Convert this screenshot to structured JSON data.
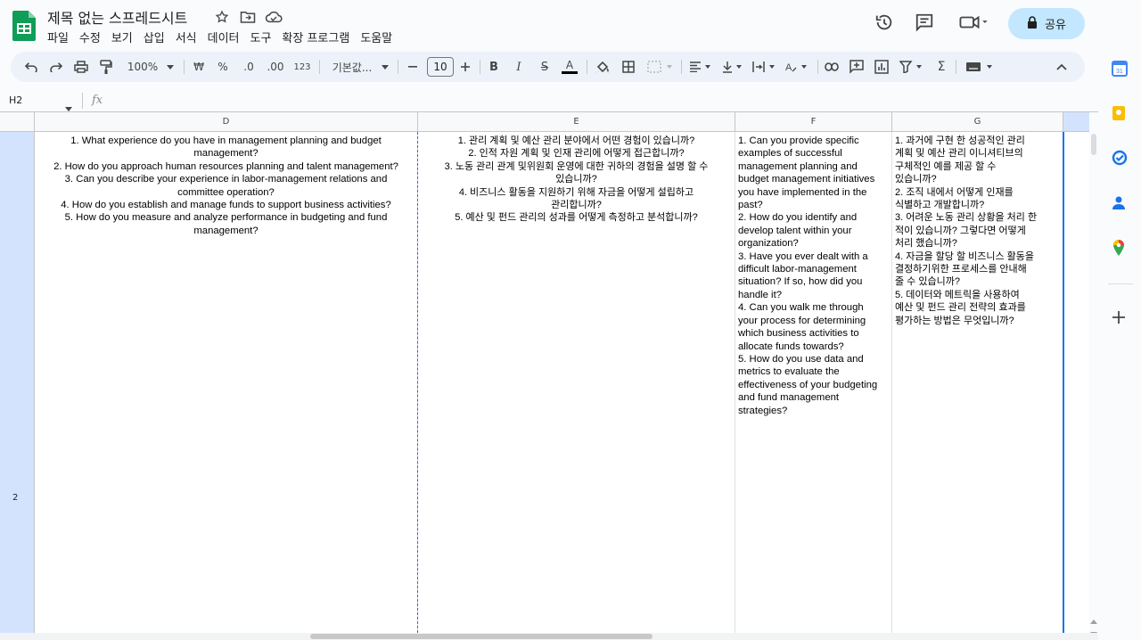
{
  "app": {
    "title": "제목 없는 스프레드시트",
    "share_label": "공유"
  },
  "menu": [
    "파일",
    "수정",
    "보기",
    "삽입",
    "서식",
    "데이터",
    "도구",
    "확장 프로그램",
    "도움말"
  ],
  "toolbar": {
    "zoom": "100%",
    "currency": "₩",
    "percent": "%",
    "decrease_decimal": ".0",
    "increase_decimal": ".00",
    "number_format": "123",
    "font": "기본값...",
    "font_size": "10",
    "bold": "B",
    "italic": "I",
    "strike": "S",
    "text_color": "A",
    "sum": "Σ"
  },
  "formula_bar": {
    "cell_ref": "H2",
    "fx": "fx"
  },
  "columns": [
    "D",
    "E",
    "F",
    "G"
  ],
  "row": "2",
  "cells": {
    "D": [
      "1. What experience do you have in management planning and budget",
      "management?",
      "2. How do you approach human resources planning and talent management?",
      "3. Can you describe your experience in labor-management relations and",
      "committee operation?",
      "4. How do you establish and manage funds to support business activities?",
      "5. How do you measure and analyze performance in budgeting and fund",
      "management?"
    ],
    "E": [
      "1. 관리 계획 및 예산 관리 분야에서 어떤 경험이 있습니까?",
      "2. 인적 자원 계획 및 인재 관리에 어떻게 접근합니까?",
      "3. 노동 관리 관계 및위원회 운영에 대한 귀하의 경험을 설명 할 수",
      "있습니까?",
      "4. 비즈니스 활동을 지원하기 위해 자금을 어떻게 설립하고",
      "관리합니까?",
      "5. 예산 및 펀드 관리의 성과를 어떻게 측정하고 분석합니까?"
    ],
    "F": [
      "1. Can you provide specific",
      "examples of successful",
      "management planning and",
      "budget management initiatives",
      "you have implemented in the",
      "past?",
      "2. How do you identify and",
      "develop talent within your",
      "organization?",
      "3. Have you ever dealt with a",
      "difficult labor-management",
      "situation? If so, how did you",
      "handle it?",
      "4. Can you walk me through",
      "your process for determining",
      "which business activities to",
      "allocate funds towards?",
      "5. How do you use data and",
      "metrics to evaluate the",
      "effectiveness of your budgeting",
      "and fund management",
      "strategies?"
    ],
    "G": [
      "1. 과거에 구현 한 성공적인 관리",
      "계획 및 예산 관리 이니셔티브의",
      "구체적인 예를 제공 할 수",
      "있습니까?",
      "2. 조직 내에서 어떻게 인재를",
      "식별하고 개발합니까?",
      "3. 어려운 노동 관리 상황을 처리 한",
      "적이 있습니까? 그렇다면 어떻게",
      "처리 했습니까?",
      "4. 자금을 할당 할 비즈니스 활동을",
      "결정하기위한 프로세스를 안내해",
      "줄 수 있습니까?",
      "5. 데이터와 메트릭을 사용하여",
      "예산 및 펀드 관리 전략의 효과를",
      "평가하는 방법은 무엇입니까?"
    ]
  },
  "colors": {
    "accent": "#1a73e8",
    "share_bg": "#c2e7ff",
    "toolbar_bg": "#edf2fa",
    "sheets_green": "#0f9d58"
  }
}
